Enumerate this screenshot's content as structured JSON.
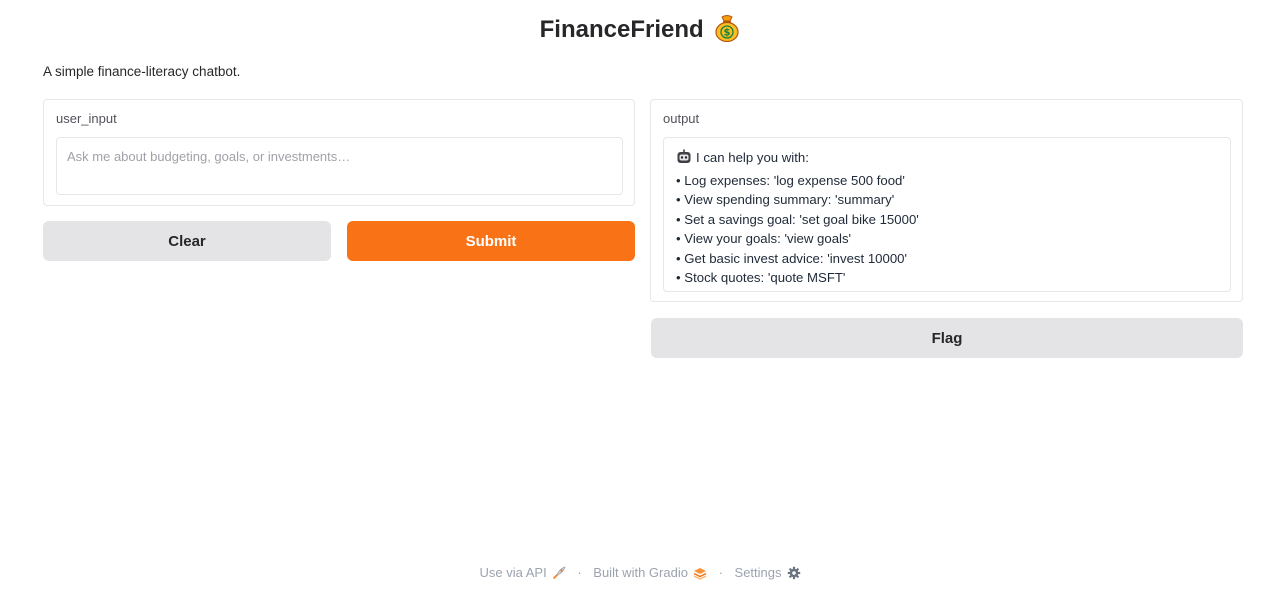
{
  "header": {
    "title": "FinanceFriend",
    "title_emoji": "money-bag-icon",
    "description": "A simple finance-literacy chatbot."
  },
  "input_panel": {
    "label": "user_input",
    "value": "",
    "placeholder": "Ask me about budgeting, goals, or investments…"
  },
  "output_panel": {
    "label": "output",
    "lines": [
      "I can help you with:",
      "• Log expenses: 'log expense 500 food'",
      "• View spending summary: 'summary'",
      "• Set a savings goal: 'set goal bike 15000'",
      "• View your goals: 'view goals'",
      "• Get basic invest advice: 'invest 10000'",
      "• Stock quotes: 'quote MSFT'"
    ]
  },
  "buttons": {
    "clear": "Clear",
    "submit": "Submit",
    "flag": "Flag"
  },
  "footer": {
    "api": "Use via API",
    "built": "Built with Gradio",
    "settings": "Settings",
    "separator": "·"
  },
  "colors": {
    "accent": "#f97316",
    "secondary_button": "#e4e4e7",
    "border": "#e5e7eb"
  }
}
